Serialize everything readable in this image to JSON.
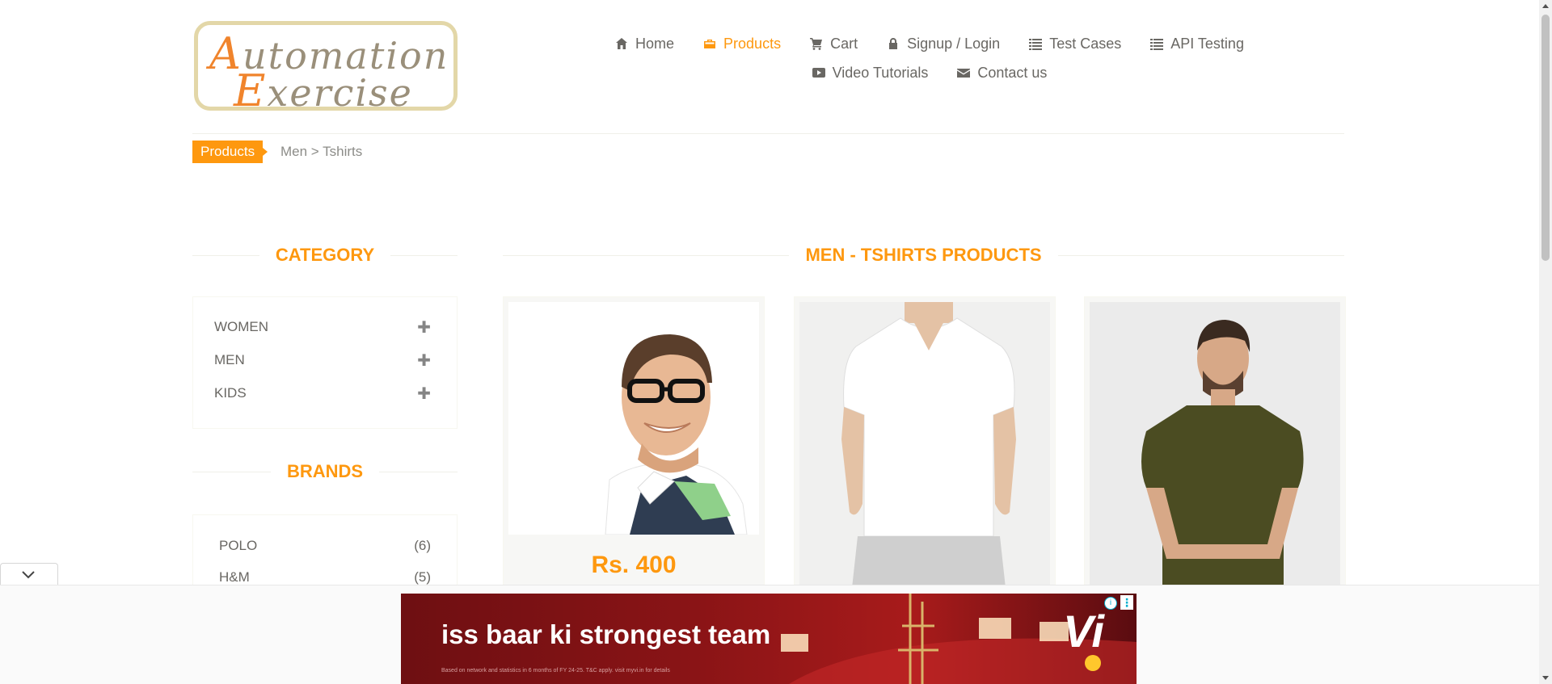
{
  "logo": {
    "line1_cap": "A",
    "line1_rest": "utomation",
    "line2_cap": "E",
    "line2_rest": "xercise"
  },
  "nav": {
    "row1": [
      {
        "label": "Home",
        "icon": "home-icon",
        "active": false
      },
      {
        "label": "Products",
        "icon": "briefcase-icon",
        "active": true
      },
      {
        "label": "Cart",
        "icon": "cart-icon",
        "active": false
      },
      {
        "label": "Signup / Login",
        "icon": "lock-icon",
        "active": false
      },
      {
        "label": "Test Cases",
        "icon": "list-icon",
        "active": false
      },
      {
        "label": "API Testing",
        "icon": "list-icon",
        "active": false
      }
    ],
    "row2": [
      {
        "label": "Video Tutorials",
        "icon": "youtube-play-icon"
      },
      {
        "label": "Contact us",
        "icon": "envelope-icon"
      }
    ]
  },
  "breadcrumb": {
    "badge": "Products",
    "path": "Men > Tshirts"
  },
  "sidebar": {
    "category_title": "CATEGORY",
    "categories": [
      "WOMEN",
      "MEN",
      "KIDS"
    ],
    "brands_title": "BRANDS",
    "brands": [
      {
        "name": "POLO",
        "count": "(6)"
      },
      {
        "name": "H&M",
        "count": "(5)"
      }
    ]
  },
  "main": {
    "title": "MEN - TSHIRTS PRODUCTS",
    "products": [
      {
        "price": "Rs. 400",
        "image": "man-with-glasses-polo-image"
      },
      {
        "image": "white-vneck-tshirt-image"
      },
      {
        "image": "olive-henley-shirt-image"
      }
    ]
  },
  "ad": {
    "headline": "iss baar ki strongest team",
    "brand": "Vi",
    "fineprint": "Based on network and statistics in 6 months of FY 24-25. T&C apply. visit myvi.in for details"
  },
  "colors": {
    "accent": "#fe980f",
    "text": "#696763",
    "ad_bg": "#8a1416"
  }
}
